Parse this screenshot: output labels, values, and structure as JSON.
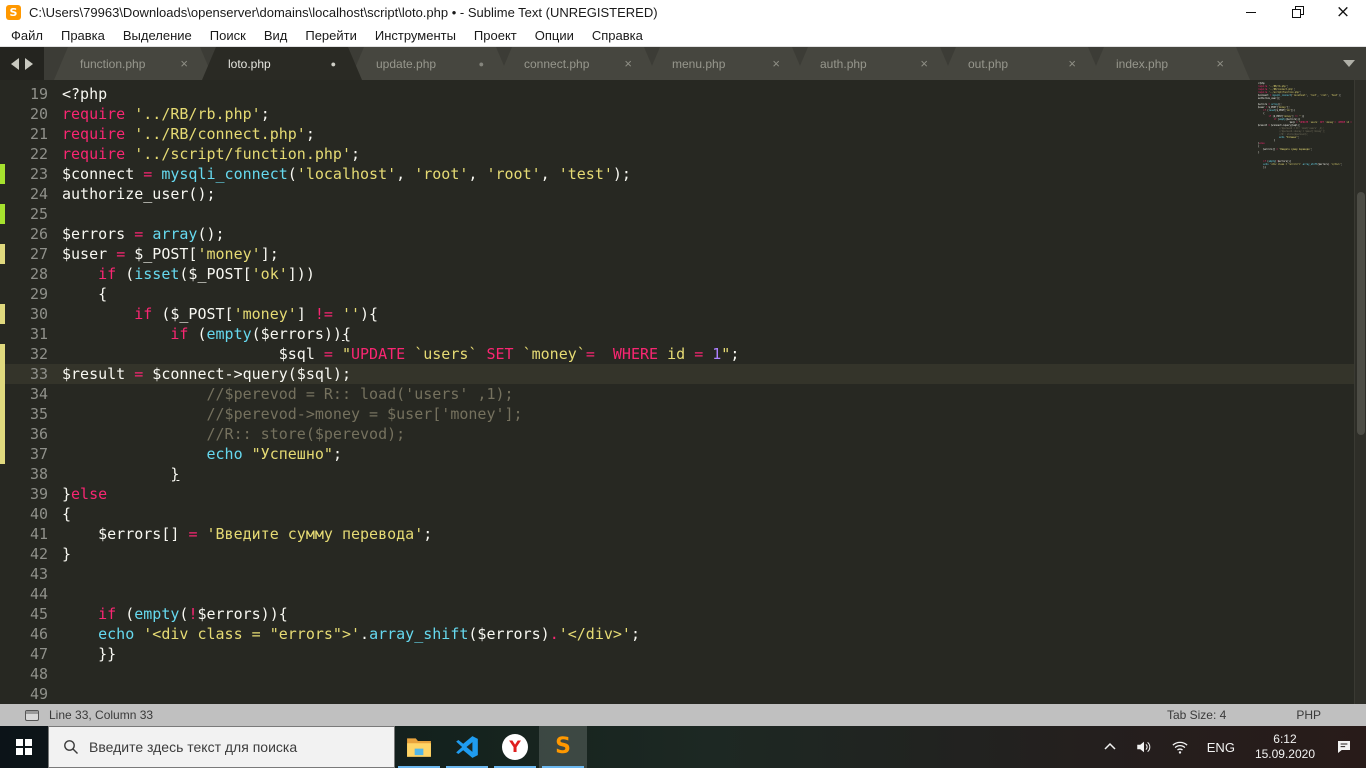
{
  "window": {
    "title": "C:\\Users\\79963\\Downloads\\openserver\\domains\\localhost\\script\\loto.php • - Sublime Text (UNREGISTERED)"
  },
  "menu": {
    "items": [
      "Файл",
      "Правка",
      "Выделение",
      "Поиск",
      "Вид",
      "Перейти",
      "Инструменты",
      "Проект",
      "Опции",
      "Справка"
    ]
  },
  "tabs": [
    {
      "label": "function.php",
      "state": "close",
      "active": false
    },
    {
      "label": "loto.php",
      "state": "dirty",
      "active": true
    },
    {
      "label": "update.php",
      "state": "dirty",
      "active": false
    },
    {
      "label": "connect.php",
      "state": "close",
      "active": false
    },
    {
      "label": "menu.php",
      "state": "close",
      "active": false
    },
    {
      "label": "auth.php",
      "state": "close",
      "active": false
    },
    {
      "label": "out.php",
      "state": "close",
      "active": false
    },
    {
      "label": "index.php",
      "state": "close",
      "active": false
    }
  ],
  "editor": {
    "first_line": 19,
    "current_line": 33,
    "gutter_markers": {
      "added": [
        23,
        25
      ],
      "modified": [
        27,
        30,
        32,
        33,
        34,
        35,
        36,
        37
      ]
    },
    "lines": [
      {
        "n": 19,
        "t": [
          [
            "<?php",
            "w"
          ]
        ]
      },
      {
        "n": 20,
        "t": [
          [
            "require",
            "k"
          ],
          [
            " ",
            "w"
          ],
          [
            "'../RB/rb.php'",
            "s"
          ],
          [
            ";",
            "w"
          ]
        ]
      },
      {
        "n": 21,
        "t": [
          [
            "require",
            "k"
          ],
          [
            " ",
            "w"
          ],
          [
            "'../RB/connect.php'",
            "s"
          ],
          [
            ";",
            "w"
          ]
        ]
      },
      {
        "n": 22,
        "t": [
          [
            "require",
            "k"
          ],
          [
            " ",
            "w"
          ],
          [
            "'../script/function.php'",
            "s"
          ],
          [
            ";",
            "w"
          ]
        ]
      },
      {
        "n": 23,
        "t": [
          [
            "$connect ",
            "w"
          ],
          [
            "=",
            "k"
          ],
          [
            " ",
            "w"
          ],
          [
            "mysqli_connect",
            "f"
          ],
          [
            "(",
            "w"
          ],
          [
            "'localhost'",
            "s"
          ],
          [
            ", ",
            "w"
          ],
          [
            "'root'",
            "s"
          ],
          [
            ", ",
            "w"
          ],
          [
            "'root'",
            "s"
          ],
          [
            ", ",
            "w"
          ],
          [
            "'test'",
            "s"
          ],
          [
            ");",
            "w"
          ]
        ]
      },
      {
        "n": 24,
        "t": [
          [
            "authorize_user();",
            "w"
          ]
        ]
      },
      {
        "n": 25,
        "t": []
      },
      {
        "n": 26,
        "t": [
          [
            "$errors ",
            "w"
          ],
          [
            "=",
            "k"
          ],
          [
            " ",
            "w"
          ],
          [
            "array",
            "f"
          ],
          [
            "();",
            "w"
          ]
        ]
      },
      {
        "n": 27,
        "t": [
          [
            "$user ",
            "w"
          ],
          [
            "=",
            "k"
          ],
          [
            " $_POST[",
            "w"
          ],
          [
            "'money'",
            "s"
          ],
          [
            "];",
            "w"
          ]
        ]
      },
      {
        "n": 28,
        "t": [
          [
            "    ",
            "w"
          ],
          [
            "if",
            "k"
          ],
          [
            " (",
            "w"
          ],
          [
            "isset",
            "f"
          ],
          [
            "($_POST[",
            "w"
          ],
          [
            "'ok'",
            "s"
          ],
          [
            "]))",
            "w"
          ]
        ]
      },
      {
        "n": 29,
        "t": [
          [
            "    {",
            "w"
          ]
        ]
      },
      {
        "n": 30,
        "t": [
          [
            "        ",
            "w"
          ],
          [
            "if",
            "k"
          ],
          [
            " ($_POST[",
            "w"
          ],
          [
            "'money'",
            "s"
          ],
          [
            "] ",
            "w"
          ],
          [
            "!=",
            "k"
          ],
          [
            " ",
            "w"
          ],
          [
            "''",
            "s"
          ],
          [
            "){",
            "w"
          ]
        ]
      },
      {
        "n": 31,
        "t": [
          [
            "            ",
            "w"
          ],
          [
            "if",
            "k"
          ],
          [
            " (",
            "w"
          ],
          [
            "empty",
            "f"
          ],
          [
            "($errors))",
            "w"
          ],
          [
            "{",
            "w",
            "u"
          ]
        ]
      },
      {
        "n": 32,
        "t": [
          [
            "                        ",
            "w"
          ],
          [
            "$sql ",
            "w"
          ],
          [
            "=",
            "k"
          ],
          [
            " ",
            "w"
          ],
          [
            "\"",
            "s"
          ],
          [
            "UPDATE",
            "k"
          ],
          [
            " ",
            "s"
          ],
          [
            "`users`",
            "s"
          ],
          [
            " ",
            "s"
          ],
          [
            "SET",
            "k"
          ],
          [
            " ",
            "s"
          ],
          [
            "`money`",
            "s"
          ],
          [
            "=",
            "k"
          ],
          [
            "  ",
            "s"
          ],
          [
            "WHERE",
            "k"
          ],
          [
            " id ",
            "s"
          ],
          [
            "=",
            "k"
          ],
          [
            " ",
            "s"
          ],
          [
            "1",
            "n"
          ],
          [
            "\"",
            "s"
          ],
          [
            ";",
            "w"
          ]
        ]
      },
      {
        "n": 33,
        "t": [
          [
            "$result ",
            "w"
          ],
          [
            "=",
            "k"
          ],
          [
            " $connect->query($sql);",
            "w"
          ]
        ]
      },
      {
        "n": 34,
        "t": [
          [
            "                ",
            "w"
          ],
          [
            "//$perevod = R:: load('users' ,1);",
            "c"
          ]
        ]
      },
      {
        "n": 35,
        "t": [
          [
            "                ",
            "w"
          ],
          [
            "//$perevod->money = $user['money'];",
            "c"
          ]
        ]
      },
      {
        "n": 36,
        "t": [
          [
            "                ",
            "w"
          ],
          [
            "//R:: store($perevod);",
            "c"
          ]
        ]
      },
      {
        "n": 37,
        "t": [
          [
            "                ",
            "w"
          ],
          [
            "echo",
            "f"
          ],
          [
            " ",
            "w"
          ],
          [
            "\"Успешно\"",
            "s"
          ],
          [
            ";",
            "w"
          ]
        ]
      },
      {
        "n": 38,
        "t": [
          [
            "            ",
            "w"
          ],
          [
            "}",
            "w",
            "u"
          ]
        ]
      },
      {
        "n": 39,
        "t": [
          [
            "}",
            "w"
          ],
          [
            "else",
            "k"
          ]
        ]
      },
      {
        "n": 40,
        "t": [
          [
            "{",
            "w"
          ]
        ]
      },
      {
        "n": 41,
        "t": [
          [
            "    $errors[] ",
            "w"
          ],
          [
            "=",
            "k"
          ],
          [
            " ",
            "w"
          ],
          [
            "'Введите сумму перевода'",
            "s"
          ],
          [
            ";",
            "w"
          ]
        ]
      },
      {
        "n": 42,
        "t": [
          [
            "}",
            "w"
          ]
        ]
      },
      {
        "n": 43,
        "t": []
      },
      {
        "n": 44,
        "t": []
      },
      {
        "n": 45,
        "t": [
          [
            "    ",
            "w"
          ],
          [
            "if",
            "k"
          ],
          [
            " (",
            "w"
          ],
          [
            "empty",
            "f"
          ],
          [
            "(",
            "w"
          ],
          [
            "!",
            "k"
          ],
          [
            "$errors)){",
            "w"
          ]
        ]
      },
      {
        "n": 46,
        "t": [
          [
            "    ",
            "w"
          ],
          [
            "echo",
            "f"
          ],
          [
            " ",
            "w"
          ],
          [
            "'<div class = \"errors\">'",
            "s"
          ],
          [
            ".",
            "w"
          ],
          [
            "array_shift",
            "f"
          ],
          [
            "($errors)",
            "w"
          ],
          [
            ".",
            "k"
          ],
          [
            "'</div>'",
            "s"
          ],
          [
            ";",
            "w"
          ]
        ]
      },
      {
        "n": 47,
        "t": [
          [
            "    }}",
            "w"
          ]
        ]
      },
      {
        "n": 48,
        "t": []
      },
      {
        "n": 49,
        "t": []
      }
    ]
  },
  "status_bar": {
    "position": "Line 33, Column 33",
    "tab_size": "Tab Size: 4",
    "syntax": "PHP"
  },
  "taskbar": {
    "search_placeholder": "Введите здесь текст для поиска",
    "apps": [
      "file-explorer",
      "vscode",
      "yandex-browser",
      "sublime-text"
    ],
    "active_app": "sublime-text",
    "language": "ENG",
    "time": "6:12",
    "date": "15.09.2020"
  },
  "colors": {
    "editor_background": "#272822",
    "foreground": "#f8f8f2",
    "keyword": "#f92672",
    "function": "#66d9ef",
    "string": "#e6db74",
    "number": "#ae81ff",
    "comment": "#75715e",
    "line_number": "#8f908a",
    "current_line": "#34342a",
    "marker_added": "#a6e22e",
    "marker_modified": "#e0d97e",
    "sublime_orange": "#ff9800",
    "yandex_red": "#e01e1e",
    "vscode_blue": "#1f9cf0",
    "folder_yellow": "#ffd567",
    "taskbar_underline": "#6cb8f0"
  }
}
